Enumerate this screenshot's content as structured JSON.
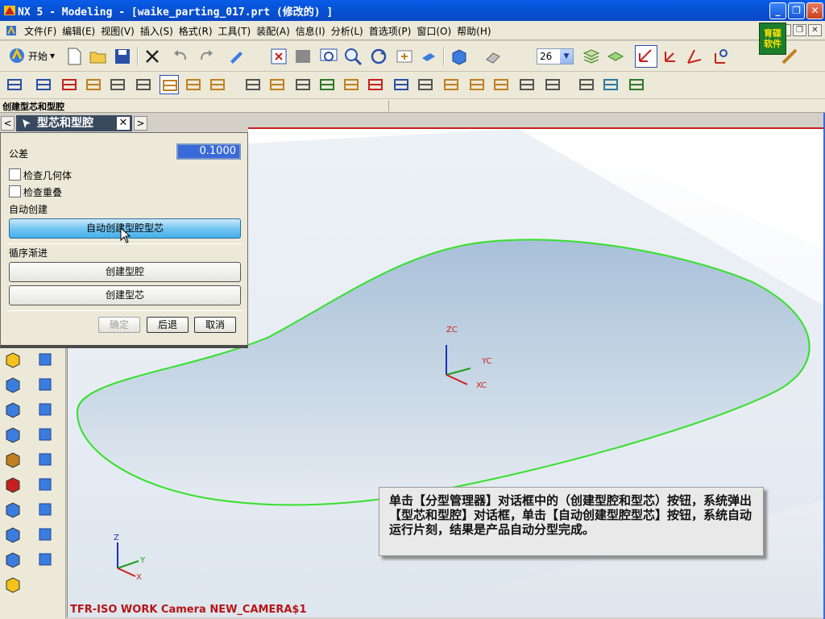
{
  "window": {
    "title": "NX 5 - Modeling - [waike_parting_017.prt  (修改的) ]",
    "minimize": "_",
    "restore": "❐",
    "close": "✕"
  },
  "menu": {
    "items": [
      "文件(F)",
      "编辑(E)",
      "视图(V)",
      "插入(S)",
      "格式(R)",
      "工具(T)",
      "装配(A)",
      "信息(I)",
      "分析(L)",
      "首选项(P)",
      "窗口(O)",
      "帮助(H)"
    ],
    "brand_logo": "育碟软件"
  },
  "toolbar": {
    "start_label": "开始",
    "layer_value": "26"
  },
  "status": {
    "prompt": "创建型芯和型腔"
  },
  "dialog": {
    "tab_title": "型芯和型腔",
    "tab_close": "✕",
    "nav_prev": "<",
    "nav_next": ">",
    "tolerance_label": "公差",
    "tolerance_value": "0.1000",
    "check_geometry": "检查几何体",
    "check_overlap": "检查重叠",
    "auto_section": "自动创建",
    "auto_button": "自动创建型腔型芯",
    "step_section": "循序渐进",
    "create_cavity": "创建型腔",
    "create_core": "创建型芯",
    "ok": "确定",
    "back": "后退",
    "cancel": "取消"
  },
  "viewport": {
    "camera_label": "TFR-ISO WORK Camera NEW_CAMERA$1",
    "axes": {
      "zc": "ZC",
      "yc": "YC",
      "xc": "XC",
      "z": "Z",
      "y": "Y",
      "x": "X"
    },
    "caption": "单击【分型管理器】对话框中的（创建型腔和型芯）按钮，系统弹出【型芯和型腔】对话框，单击【自动创建型腔型芯】按钮，系统自动运行片刻，结果是产品自动分型完成。"
  },
  "colors": {
    "title_bar": "#0653d6",
    "outline": "#35e02a",
    "surface": "#bcd0e2",
    "axis_red": "#cc1e1e",
    "axis_green": "#1aa01a",
    "axis_blue": "#1c2fbf"
  }
}
